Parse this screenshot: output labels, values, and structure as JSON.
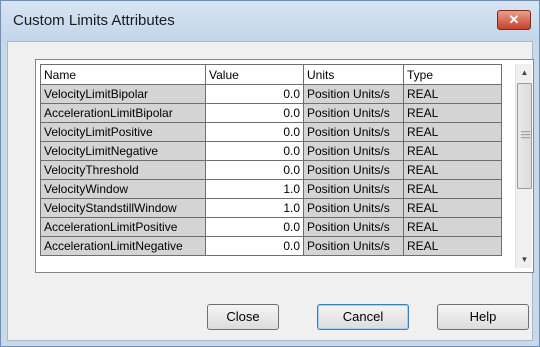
{
  "window": {
    "title": "Custom Limits Attributes",
    "close_glyph": "✕"
  },
  "grid": {
    "headers": [
      "Name",
      "Value",
      "Units",
      "Type"
    ],
    "rows": [
      {
        "name": "VelocityLimitBipolar",
        "value": "0.0",
        "units": "Position Units/s",
        "type": "REAL"
      },
      {
        "name": "AccelerationLimitBipolar",
        "value": "0.0",
        "units": "Position Units/s",
        "type": "REAL"
      },
      {
        "name": "VelocityLimitPositive",
        "value": "0.0",
        "units": "Position Units/s",
        "type": "REAL"
      },
      {
        "name": "VelocityLimitNegative",
        "value": "0.0",
        "units": "Position Units/s",
        "type": "REAL"
      },
      {
        "name": "VelocityThreshold",
        "value": "0.0",
        "units": "Position Units/s",
        "type": "REAL"
      },
      {
        "name": "VelocityWindow",
        "value": "1.0",
        "units": "Position Units/s",
        "type": "REAL"
      },
      {
        "name": "VelocityStandstillWindow",
        "value": "1.0",
        "units": "Position Units/s",
        "type": "REAL"
      },
      {
        "name": "AccelerationLimitPositive",
        "value": "0.0",
        "units": "Position Units/s",
        "type": "REAL"
      },
      {
        "name": "AccelerationLimitNegative",
        "value": "0.0",
        "units": "Position Units/s",
        "type": "REAL"
      }
    ]
  },
  "buttons": {
    "close": "Close",
    "cancel": "Cancel",
    "help": "Help"
  },
  "icons": {
    "scroll_up": "arrow-up-icon",
    "scroll_down": "arrow-down-icon"
  }
}
